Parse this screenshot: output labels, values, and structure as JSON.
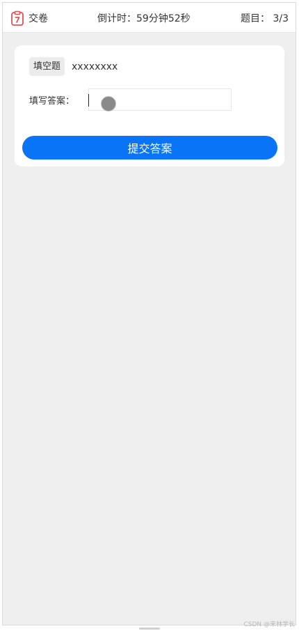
{
  "header": {
    "submit_paper_label": "交卷",
    "submit_paper_icon": "clipboard-icon",
    "countdown_text": "倒计时：59分钟52秒",
    "progress_text": "题目： 3/3"
  },
  "question": {
    "type_label": "填空题",
    "text": "xxxxxxxx",
    "answer_label": "填写答案：",
    "answer_value": "",
    "submit_label": "提交答案"
  },
  "watermark": "CSDN @来林学长",
  "colors": {
    "accent": "#0a74f6",
    "icon_red": "#e05252",
    "background": "#efefef"
  }
}
